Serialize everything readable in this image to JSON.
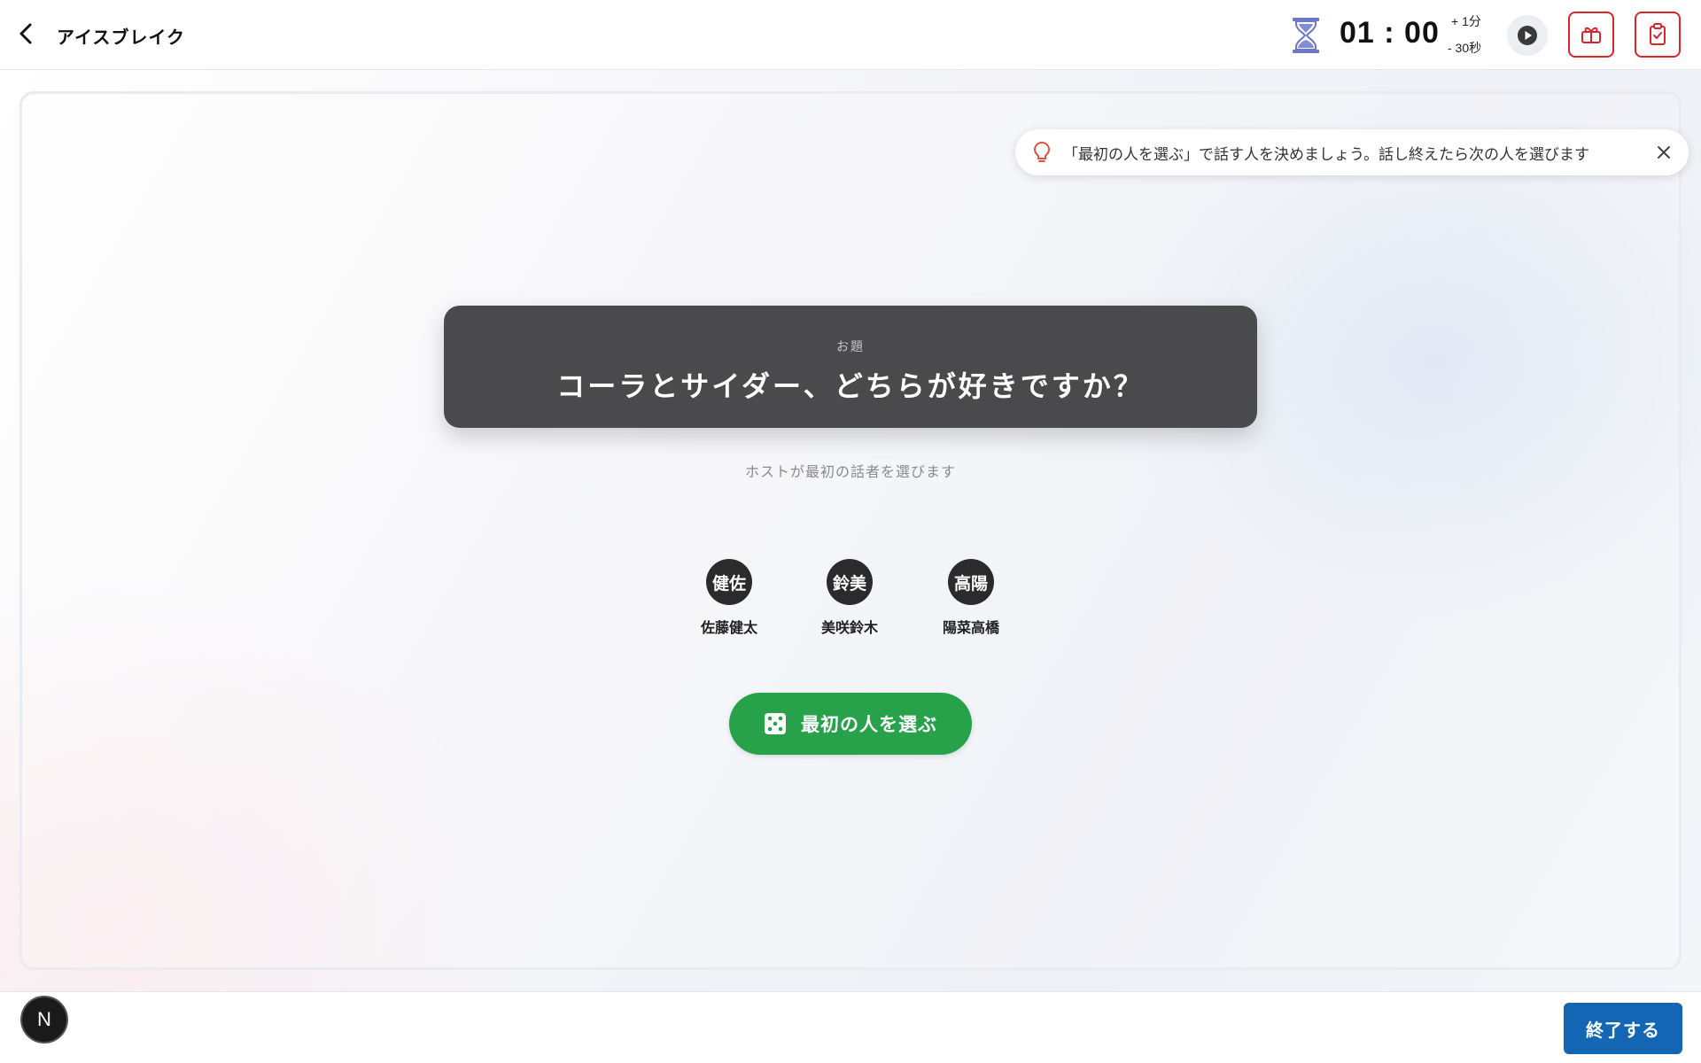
{
  "header": {
    "title": "アイスブレイク",
    "timer": "01 : 00",
    "add_time_label": "+ 1分",
    "subtract_time_label": "- 30秒",
    "icons": {
      "back": "chevron-left-icon",
      "hourglass": "hourglass-icon",
      "play": "play-icon",
      "button_1": "gift-box-icon",
      "button_2": "clipboard-check-icon"
    }
  },
  "hint": {
    "text": "「最初の人を選ぶ」で話す人を決めましょう。話し終えたら次の人を選びます",
    "icon": "lightbulb-icon"
  },
  "topic": {
    "label": "お題",
    "question": "コーラとサイダー、どちらが好きですか？"
  },
  "subtext": "ホストが最初の話者を選びます",
  "participants": [
    {
      "initials": "健佐",
      "name": "佐藤健太"
    },
    {
      "initials": "鈴美",
      "name": "美咲鈴木"
    },
    {
      "initials": "高陽",
      "name": "陽菜高橋"
    }
  ],
  "choose_button": {
    "label": "最初の人を選ぶ",
    "icon": "dice-icon"
  },
  "footer": {
    "badge": "N",
    "end_button_label": "終了する"
  },
  "colors": {
    "accent_red": "#d8262c",
    "primary_green": "#27a24a",
    "primary_blue": "#1366b4",
    "topic_card": "#4a4a4d",
    "hourglass": "#6b78c9"
  }
}
